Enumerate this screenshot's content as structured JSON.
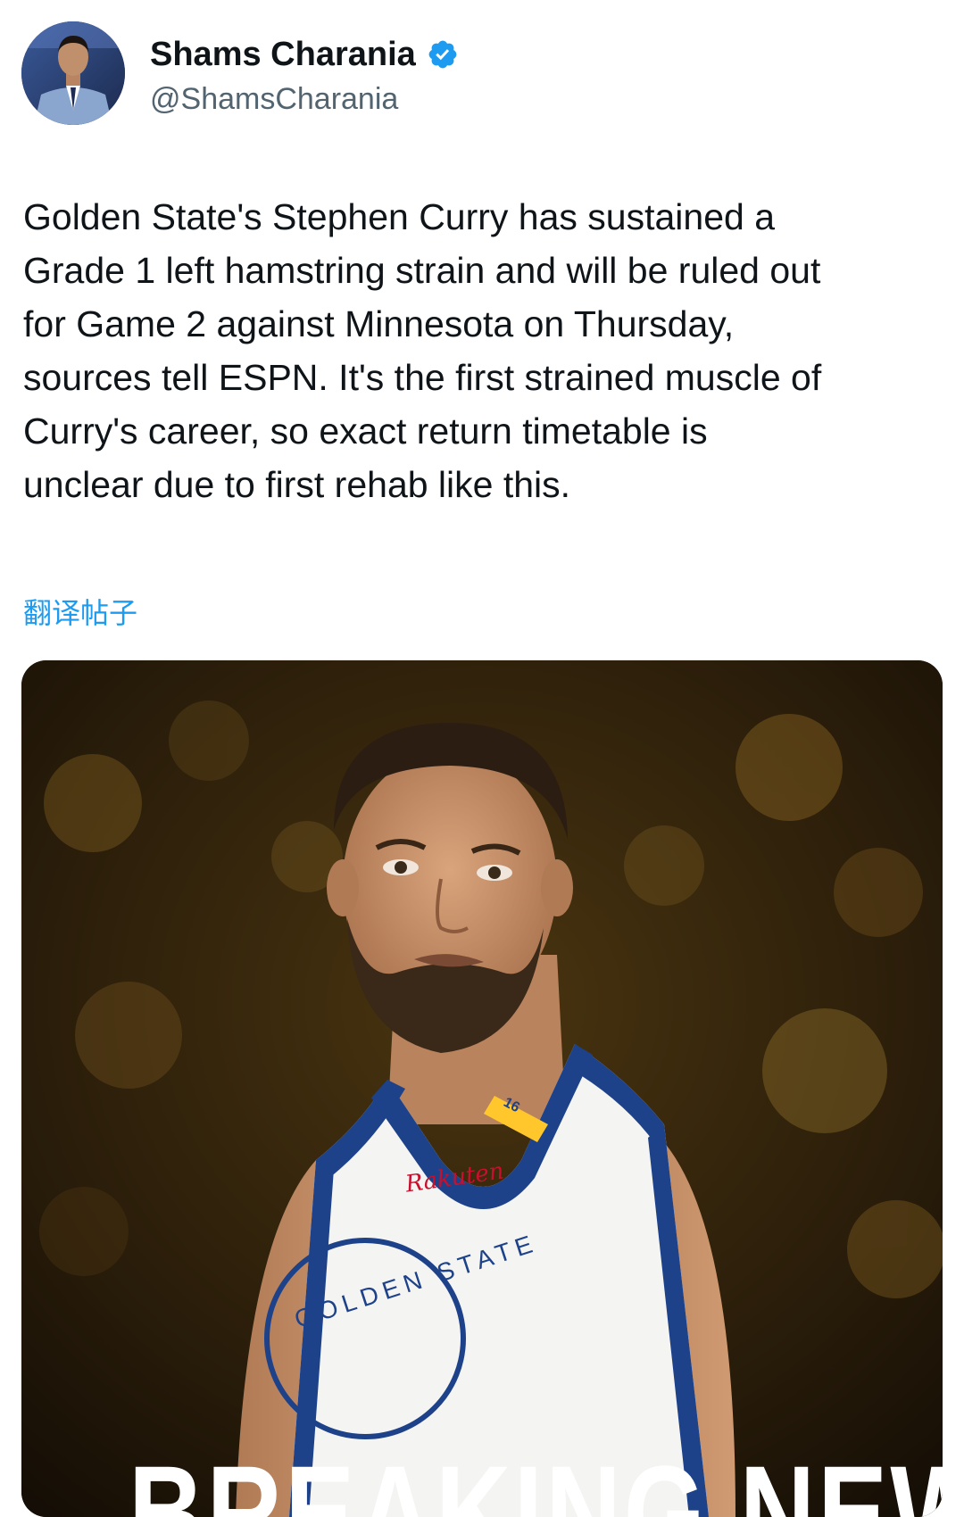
{
  "author": {
    "name": "Shams Charania",
    "handle": "@ShamsCharania",
    "verified": true,
    "avatar_icon": "person-avatar",
    "verified_icon": "verified-badge-icon",
    "verified_color": "#1d9bf0"
  },
  "tweet": {
    "text_lines": [
      "Golden State's Stephen Curry has sustained a",
      "Grade 1 left hamstring strain and will be ruled out",
      "for Game 2 against Minnesota on Thursday,",
      "sources tell ESPN. It's the first strained muscle of",
      "Curry's career, so exact return timetable is",
      "unclear due to first rehab like this."
    ],
    "translate_label": "翻译帖子"
  },
  "media": {
    "jersey_sponsor": "Rakuten",
    "jersey_number": "16",
    "jersey_logo_text": "GOLDEN STATE",
    "banner_text": "BREAKING NEWS"
  },
  "colors": {
    "text": "#0f1419",
    "secondary": "#536471",
    "link": "#1d9bf0",
    "jersey_blue": "#1d428a",
    "jersey_yellow": "#ffc72c"
  }
}
